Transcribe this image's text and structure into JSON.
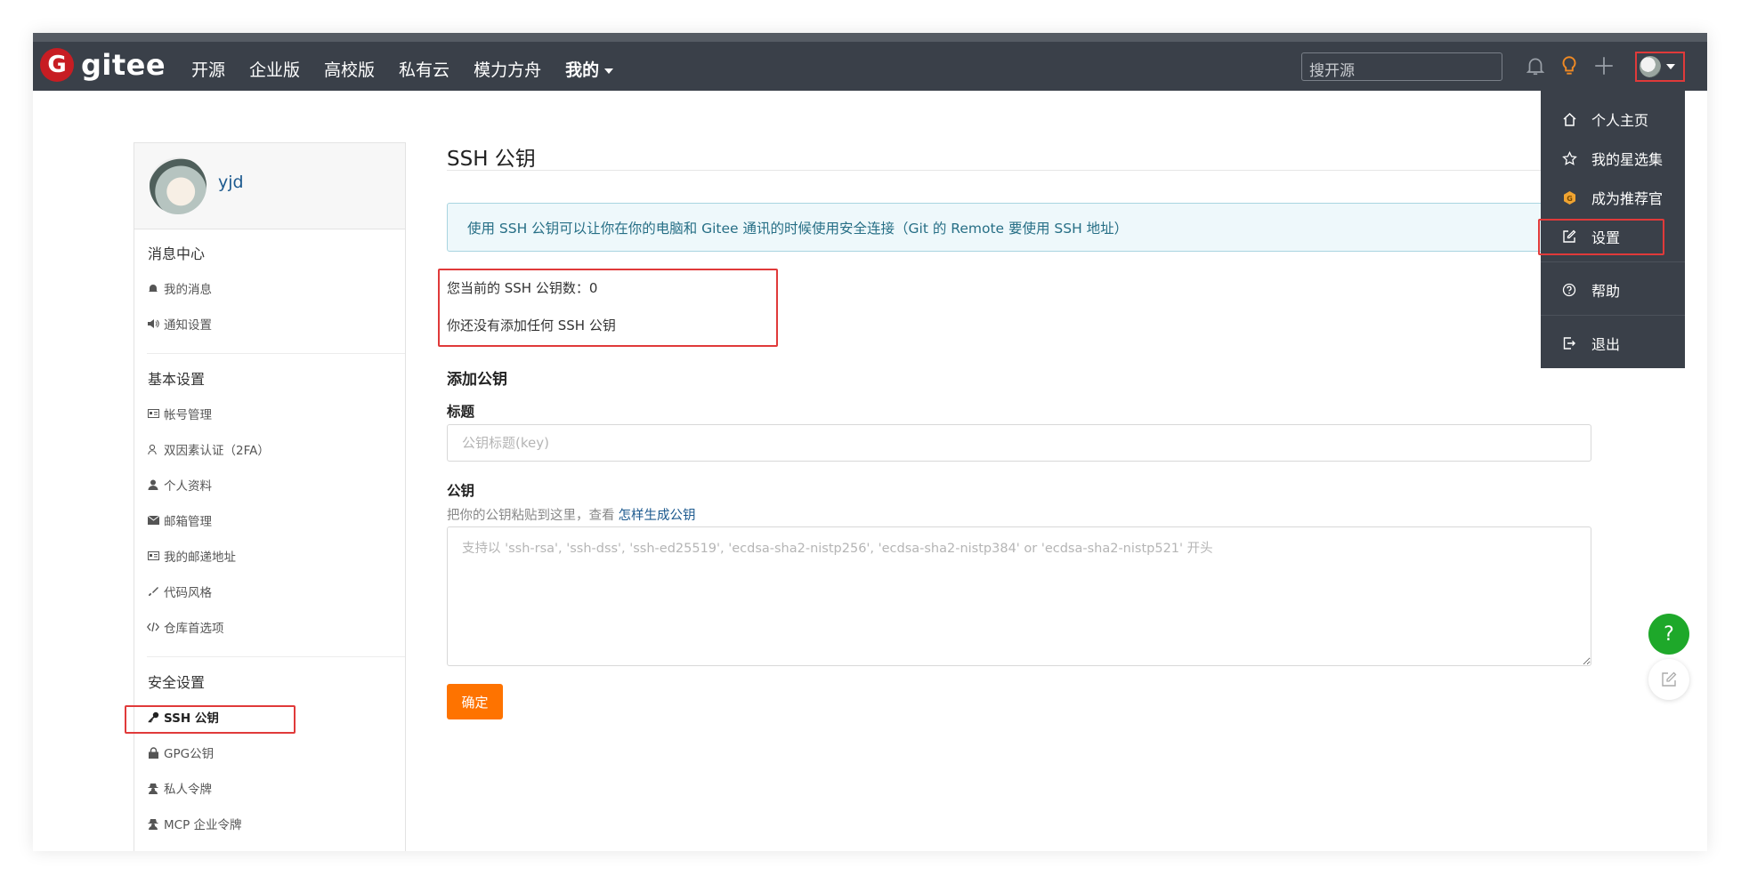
{
  "header": {
    "logo_mark": "G",
    "logo_text": "gitee",
    "nav": [
      "开源",
      "企业版",
      "高校版",
      "私有云",
      "模力方舟",
      "我的"
    ],
    "search_placeholder": "搜开源"
  },
  "dropdown": {
    "items": [
      "个人主页",
      "我的星选集",
      "成为推荐官",
      "设置",
      "帮助",
      "退出"
    ]
  },
  "sidebar": {
    "username": "yjd",
    "sections": [
      {
        "title": "消息中心",
        "items": [
          "我的消息",
          "通知设置"
        ]
      },
      {
        "title": "基本设置",
        "items": [
          "帐号管理",
          "双因素认证（2FA）",
          "个人资料",
          "邮箱管理",
          "我的邮递地址",
          "代码风格",
          "仓库首选项"
        ]
      },
      {
        "title": "安全设置",
        "items": [
          "SSH 公钥",
          "GPG公钥",
          "私人令牌",
          "MCP 企业令牌"
        ]
      }
    ]
  },
  "main": {
    "title": "SSH 公钥",
    "info": "使用 SSH 公钥可以让你在你的电脑和 Gitee 通讯的时候使用安全连接（Git 的 Remote 要使用 SSH 地址）",
    "count_label": "您当前的 SSH 公钥数：",
    "count_value": "0",
    "none_text": "你还没有添加任何 SSH 公钥",
    "add_heading": "添加公钥",
    "title_label": "标题",
    "title_placeholder": "公钥标题(key)",
    "key_label": "公钥",
    "key_hint": "把你的公钥粘贴到这里，查看",
    "key_hint_link": "怎样生成公钥",
    "key_placeholder": "支持以 'ssh-rsa', 'ssh-dss', 'ssh-ed25519', 'ecdsa-sha2-nistp256', 'ecdsa-sha2-nistp384' or 'ecdsa-sha2-nistp521' 开头",
    "confirm": "确定"
  },
  "fab": {
    "help": "?"
  },
  "colors": {
    "topbar": "#3a4049",
    "accent_orange": "#fe7300",
    "highlight_red": "#e03a3a",
    "help_green": "#1ea82a"
  }
}
